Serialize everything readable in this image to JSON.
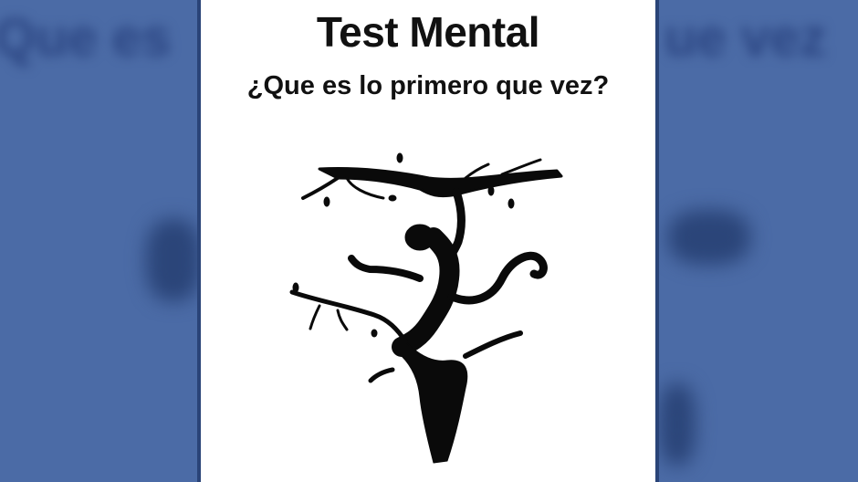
{
  "card": {
    "title": "Test Mental",
    "question": "¿Que es lo primero que vez?"
  },
  "background": {
    "left_blur_text": "Que es",
    "right_blur_text": "ue vez",
    "color": "#4b6ba6"
  },
  "illustration": {
    "icon": "tree-monkey-silhouette-icon",
    "color": "#0a0a0a"
  }
}
